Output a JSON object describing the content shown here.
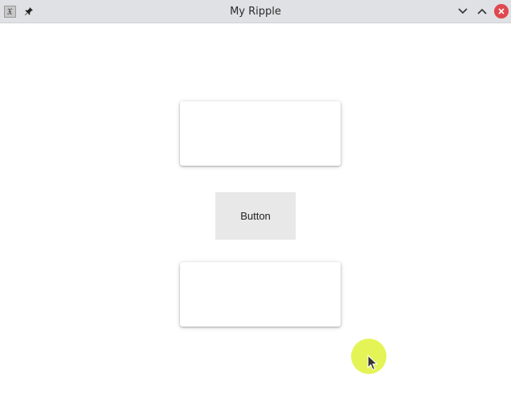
{
  "window": {
    "title": "My Ripple",
    "app_icon_glyph": "𝔛",
    "icons": {
      "app": "app-icon",
      "pin": "pin-icon",
      "minimize": "chevron-down-icon",
      "maximize": "chevron-up-icon",
      "close": "close-icon"
    },
    "colors": {
      "titlebar": "#dfe1e4",
      "close": "#e0474f",
      "ripple": "#dff23a"
    }
  },
  "main": {
    "button_label": "Button"
  }
}
